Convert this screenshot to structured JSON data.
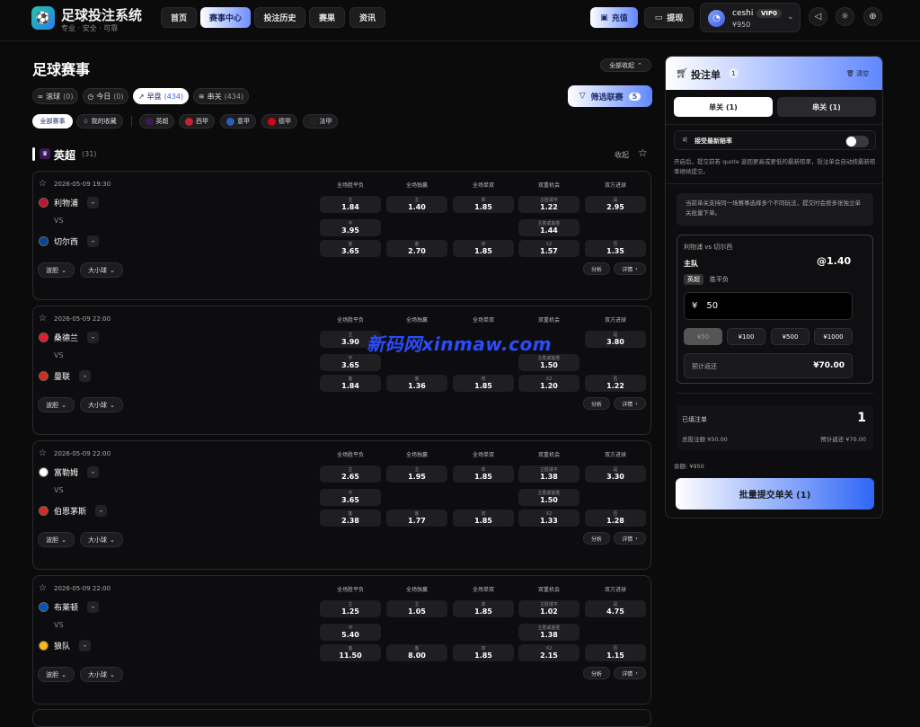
{
  "header": {
    "title": "足球投注系统",
    "subtitle": "专业 · 安全 · 可靠",
    "nav": [
      "首页",
      "赛事中心",
      "投注历史",
      "赛果",
      "资讯"
    ],
    "recharge": "充值",
    "withdraw": "提现",
    "user": {
      "name": "ceshi",
      "vip": "VIP0",
      "balance": "¥950"
    }
  },
  "main": {
    "title": "足球赛事",
    "collapse_all": "全部收起",
    "filters": [
      {
        "label": "滚球",
        "count": "(0)"
      },
      {
        "label": "今日",
        "count": "(0)"
      },
      {
        "label": "早盘",
        "count": "(434)"
      },
      {
        "label": "串关",
        "count": "(434)"
      }
    ],
    "filter_league": "筛选联赛",
    "filter_league_count": "5",
    "chips": [
      "全部赛事",
      "我的收藏",
      "英超",
      "西甲",
      "意甲",
      "德甲",
      "法甲"
    ],
    "league": {
      "name": "英超",
      "count": "(31)",
      "collapse": "收起"
    },
    "market_headers": [
      "全场胜平负",
      "全场独赢",
      "全场单双",
      "双重机会",
      "双方进球"
    ],
    "vs": "VS",
    "btn_bodan": "波胆",
    "btn_daxiao": "大小球",
    "btn_analysis": "分析",
    "btn_detail": "详情",
    "matches": [
      {
        "time": "2026-05-09 19:30",
        "home": "利物浦",
        "away": "切尔西",
        "c1": [
          [
            "主",
            "1.84"
          ],
          [
            "平",
            "3.95"
          ],
          [
            "客",
            "3.65"
          ]
        ],
        "c2": [
          [
            "主",
            "1.40"
          ],
          [
            "客",
            "2.70"
          ]
        ],
        "c3": [
          [
            "单",
            "1.85"
          ],
          [
            "双",
            "1.85"
          ]
        ],
        "c4": [
          [
            "主胜或平",
            "1.22"
          ],
          [
            "主胜或客胜",
            "1.44"
          ],
          [
            "X2",
            "1.57"
          ]
        ],
        "c5": [
          [
            "是",
            "2.95"
          ],
          [
            "否",
            "1.35"
          ]
        ]
      },
      {
        "time": "2026-05-09 22:00",
        "home": "桑德兰",
        "away": "曼联",
        "c1": [
          [
            "主",
            "3.90"
          ],
          [
            "平",
            "3.65"
          ],
          [
            "客",
            "1.84"
          ]
        ],
        "c2": [
          [
            "主",
            ""
          ],
          [
            "客",
            "1.36"
          ]
        ],
        "c3": [
          [
            "单",
            ""
          ],
          [
            "双",
            "1.85"
          ]
        ],
        "c4": [
          [
            "主胜或平",
            ""
          ],
          [
            "主胜或客胜",
            "1.50"
          ],
          [
            "X2",
            "1.20"
          ]
        ],
        "c5": [
          [
            "是",
            "3.80"
          ],
          [
            "否",
            "1.22"
          ]
        ]
      },
      {
        "time": "2026-05-09 22:00",
        "home": "富勒姆",
        "away": "伯恩茅斯",
        "c1": [
          [
            "主",
            "2.65"
          ],
          [
            "平",
            "3.65"
          ],
          [
            "客",
            "2.38"
          ]
        ],
        "c2": [
          [
            "主",
            "1.95"
          ],
          [
            "客",
            "1.77"
          ]
        ],
        "c3": [
          [
            "单",
            "1.85"
          ],
          [
            "双",
            "1.85"
          ]
        ],
        "c4": [
          [
            "主胜或平",
            "1.38"
          ],
          [
            "主胜或客胜",
            "1.50"
          ],
          [
            "X2",
            "1.33"
          ]
        ],
        "c5": [
          [
            "是",
            "3.30"
          ],
          [
            "否",
            "1.28"
          ]
        ]
      },
      {
        "time": "2026-05-09 22:00",
        "home": "布莱顿",
        "away": "狼队",
        "c1": [
          [
            "主",
            "1.25"
          ],
          [
            "平",
            "5.40"
          ],
          [
            "客",
            "11.50"
          ]
        ],
        "c2": [
          [
            "主",
            "1.05"
          ],
          [
            "客",
            "8.00"
          ]
        ],
        "c3": [
          [
            "单",
            "1.85"
          ],
          [
            "双",
            "1.85"
          ]
        ],
        "c4": [
          [
            "主胜或平",
            "1.02"
          ],
          [
            "主胜或客胜",
            "1.38"
          ],
          [
            "X2",
            "2.15"
          ]
        ],
        "c5": [
          [
            "是",
            "4.75"
          ],
          [
            "否",
            "1.15"
          ]
        ]
      }
    ]
  },
  "slip": {
    "title": "投注单",
    "count": "1",
    "clear": "清空",
    "tab_single": "单关 (1)",
    "tab_parlay": "串关 (1)",
    "accept_label": "接受最新赔率",
    "accept_note": "开启后，提交前若 quote 返回更高或更低的最新赔率，投注单会自动按最新赔率继续提交。",
    "info": "当前单关支持同一场赛事选择多个不同玩法，提交时会按多张独立单关批量下单。",
    "bet": {
      "match": "利物浦 vs 切尔西",
      "selection": "主队",
      "odds": "@1.40",
      "tag": "英超",
      "market": "胜平负",
      "currency": "¥",
      "stake": "50"
    },
    "quick_amounts": [
      "¥50",
      "¥100",
      "¥500",
      "¥1000"
    ],
    "est_label": "预计返还",
    "est_value": "¥70.00",
    "filled_label": "已填注单",
    "filled_count": "1",
    "total_stake": "总投注额 ¥50.00",
    "total_return": "预计返还 ¥70.00",
    "balance": "余额: ¥950",
    "submit": "批量提交单关 (1)"
  },
  "watermark": "新码网xinmaw.com"
}
